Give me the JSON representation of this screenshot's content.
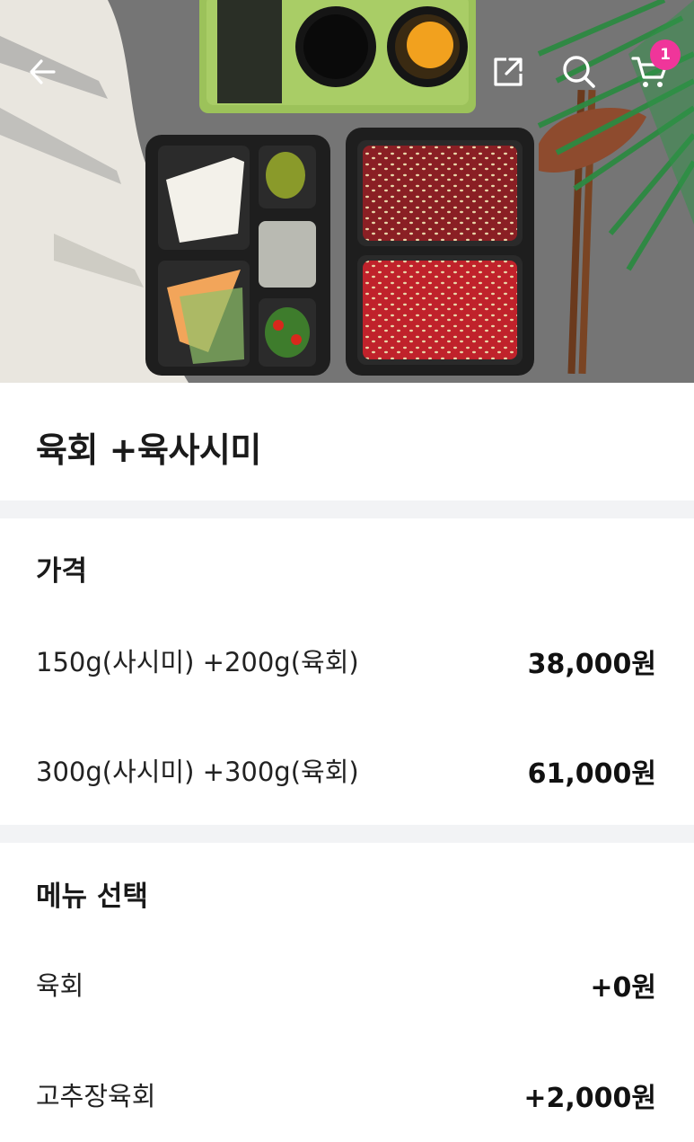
{
  "header": {
    "back_icon": "arrow-left-icon",
    "share_icon": "share-icon",
    "search_icon": "search-icon",
    "cart_icon": "cart-icon",
    "cart_count": "1",
    "badge_color": "#f0359a"
  },
  "product": {
    "title": "육회 +육사시미"
  },
  "price_section": {
    "heading": "가격",
    "options": [
      {
        "label": "150g(사시미) +200g(육회)",
        "price": "38,000원"
      },
      {
        "label": "300g(사시미) +300g(육회)",
        "price": "61,000원"
      }
    ]
  },
  "menu_section": {
    "heading": "메뉴 선택",
    "options": [
      {
        "label": "육회",
        "price": "+0원"
      },
      {
        "label": "고추장육회",
        "price": "+2,000원"
      }
    ]
  }
}
